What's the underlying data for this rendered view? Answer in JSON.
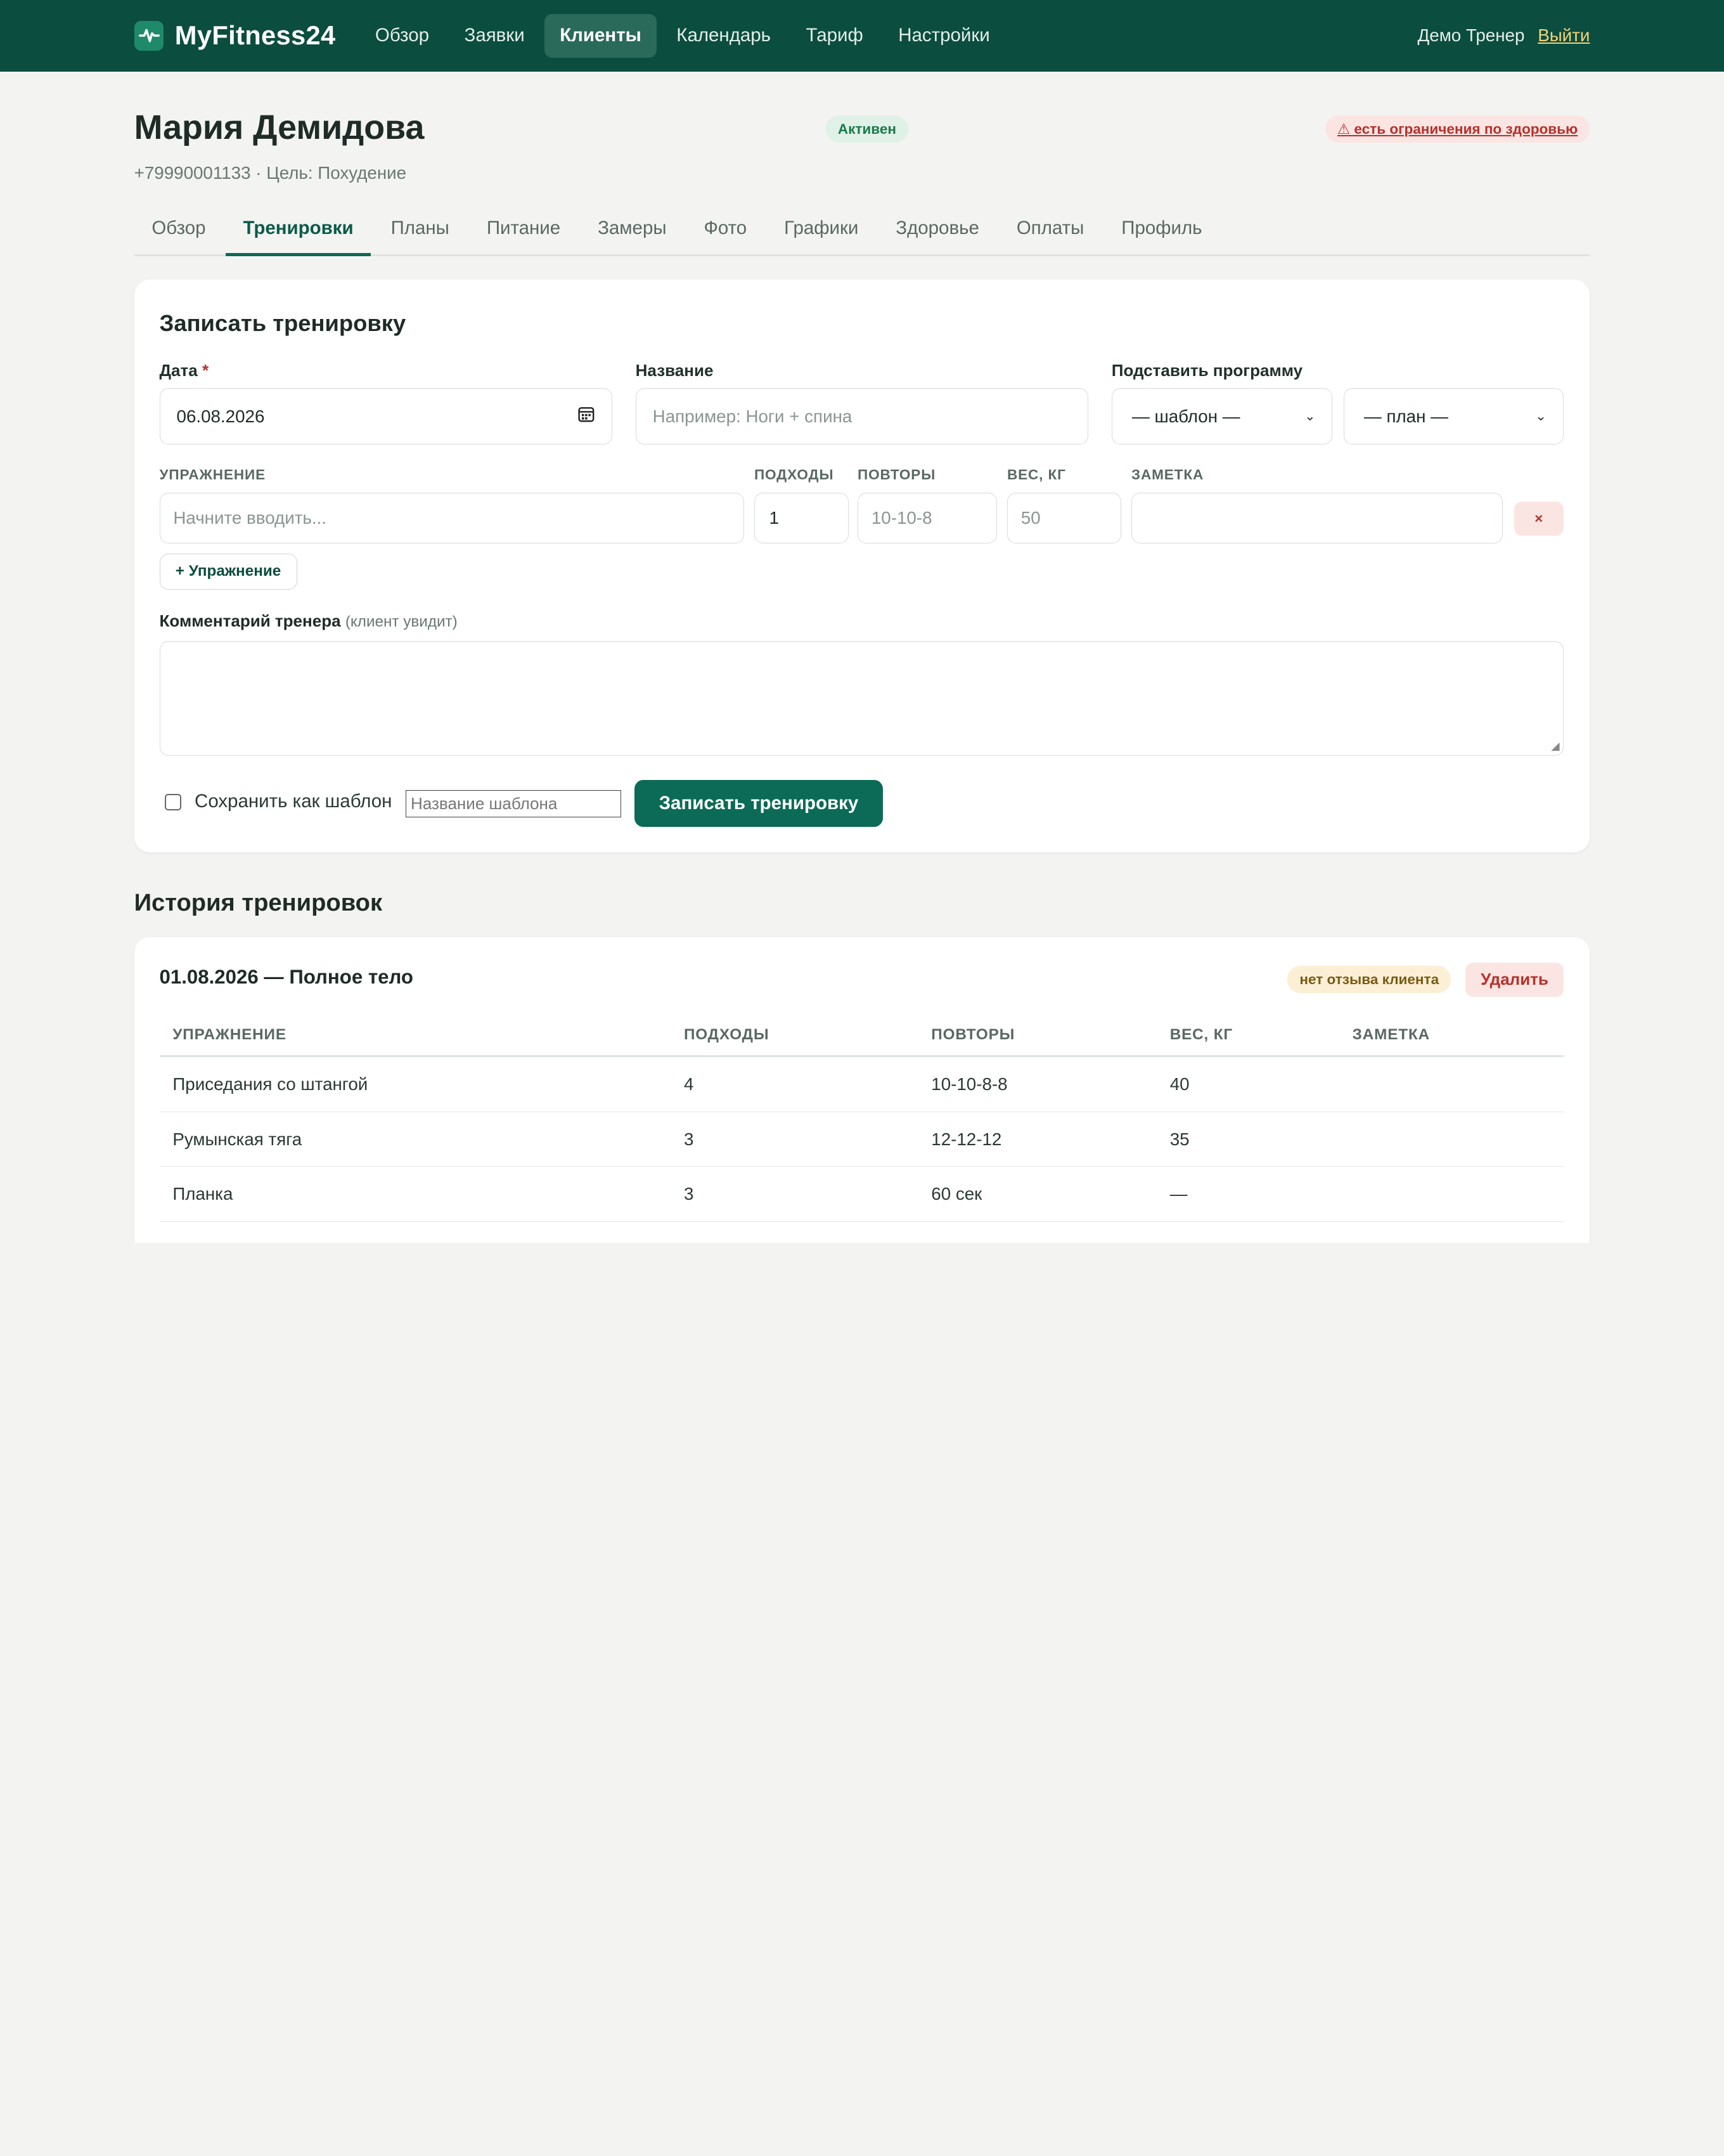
{
  "brand": {
    "name": "MyFitness24",
    "logo_icon": "pulse-icon"
  },
  "nav": {
    "items": [
      {
        "label": "Обзор",
        "active": false
      },
      {
        "label": "Заявки",
        "active": false
      },
      {
        "label": "Клиенты",
        "active": true
      },
      {
        "label": "Календарь",
        "active": false
      },
      {
        "label": "Тариф",
        "active": false
      },
      {
        "label": "Настройки",
        "active": false
      }
    ],
    "user": "Демо Тренер",
    "logout": "Выйти"
  },
  "client": {
    "name": "Мария Демидова",
    "subtitle": "+79990001133 · Цель: Похудение",
    "status": "Активен",
    "health_alert": "⚠ есть ограничения по здоровью"
  },
  "tabs": [
    "Обзор",
    "Тренировки",
    "Планы",
    "Питание",
    "Замеры",
    "Фото",
    "Графики",
    "Здоровье",
    "Оплаты",
    "Профиль"
  ],
  "active_tab": "Тренировки",
  "form": {
    "title": "Записать тренировку",
    "date_label": "Дата",
    "date_required": "*",
    "date_value": "06.08.2026",
    "name_label": "Название",
    "name_placeholder": "Например: Ноги + спина",
    "program_label": "Подставить программу",
    "template_select": "— шаблон —",
    "plan_select": "— план —",
    "col_exercise": "УПРАЖНЕНИЕ",
    "col_sets": "ПОДХОДЫ",
    "col_reps": "ПОВТОРЫ",
    "col_weight": "ВЕС, КГ",
    "col_note": "ЗАМЕТКА",
    "exercise_placeholder": "Начните вводить...",
    "sets_value": "1",
    "reps_placeholder": "10-10-8",
    "weight_placeholder": "50",
    "remove_label": "×",
    "add_exercise": "+ Упражнение",
    "comment_label": "Комментарий тренера",
    "comment_hint": "(клиент увидит)",
    "save_template_label": "Сохранить как шаблон",
    "template_name_placeholder": "Название шаблона",
    "submit": "Записать тренировку"
  },
  "history": {
    "title": "История тренировок",
    "workouts": [
      {
        "title": "01.08.2026 — Полное тело",
        "badge": "нет отзыва клиента",
        "delete": "Удалить",
        "headers": [
          "УПРАЖНЕНИЕ",
          "ПОДХОДЫ",
          "ПОВТОРЫ",
          "ВЕС, КГ",
          "ЗАМЕТКА"
        ],
        "rows": [
          [
            "Приседания со штангой",
            "4",
            "10-10-8-8",
            "40",
            ""
          ],
          [
            "Румынская тяга",
            "3",
            "12-12-12",
            "35",
            ""
          ],
          [
            "Планка",
            "3",
            "60 сек",
            "—",
            ""
          ]
        ]
      }
    ]
  },
  "colors": {
    "topbar": "#0b4d3f",
    "accent": "#0b6b56",
    "danger": "#b8302a",
    "success": "#1c7a4b"
  }
}
